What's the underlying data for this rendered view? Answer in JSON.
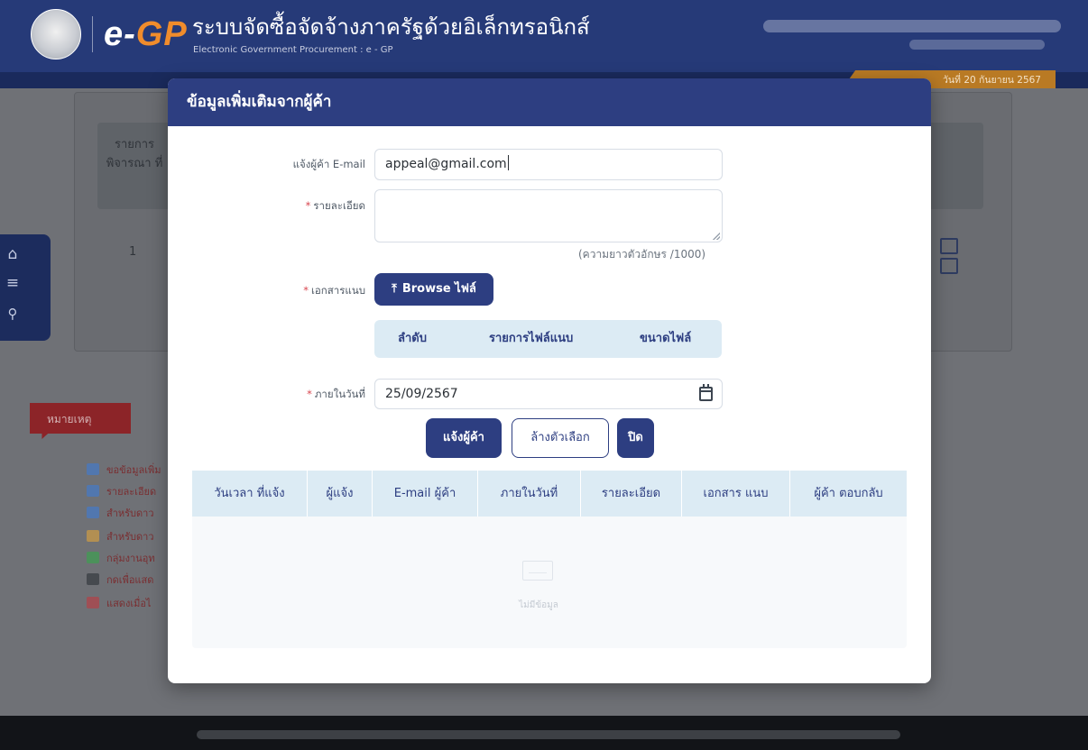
{
  "header": {
    "brand_prefix": "e-",
    "brand_suffix": "GP",
    "system_name": "ระบบจัดซื้อจัดจ้างภาครัฐด้วยอิเล็กทรอนิกส์",
    "system_name_en": "Electronic Government Procurement : e - GP",
    "date_text": "วันที่ 20 กันยายน 2567"
  },
  "background_page": {
    "column_header": "รายการ พิจารณา ที่",
    "row_number": "1",
    "notes_title": "หมายเหตุ",
    "note_items": [
      {
        "label": "ขอข้อมูลเพิ่ม",
        "color": "#3d7bd6"
      },
      {
        "label": "รายละเอียด",
        "color": "#3d7bd6"
      },
      {
        "label": "สำหรับดาว",
        "color": "#3d7bd6"
      },
      {
        "label": "สำหรับดาว",
        "color": "#e0a33a"
      },
      {
        "label": "กลุ่มงานอุท",
        "color": "#35a64a"
      },
      {
        "label": "กดเพื่อแสด",
        "color": "#2b3036"
      },
      {
        "label": "แสดงเมื่อไ",
        "color": "#c0393f"
      }
    ]
  },
  "side_nav": {
    "icons": [
      "home-icon",
      "menu-icon",
      "search-icon"
    ]
  },
  "modal": {
    "title": "ข้อมูลเพิ่มเติมจากผู้ค้า",
    "form": {
      "email_label": "แจ้งผู้ค้า E-mail",
      "email_value": "appeal@gmail.com",
      "detail_label": "รายละเอียด",
      "detail_counter": "(ความยาวตัวอักษร /1000)",
      "attachment_label": "เอกสารแนบ",
      "browse_button": "Browse ไฟล์",
      "file_table_headers": [
        "ลำดับ",
        "รายการไฟล์แนบ",
        "ขนาดไฟล์"
      ],
      "due_date_label": "ภายในวันที่",
      "due_date_value": "25/09/2567"
    },
    "actions": {
      "notify_button": "แจ้งผู้ค้า",
      "clear_button": "ล้างตัวเลือก",
      "close_button": "ปิด"
    },
    "history_table": {
      "headers": [
        "วันเวลา ที่แจ้ง",
        "ผู้แจ้ง",
        "E-mail ผู้ค้า",
        "ภายในวันที่",
        "รายละเอียด",
        "เอกสาร แนบ",
        "ผู้ค้า ตอบกลับ"
      ],
      "empty_text": "ไม่มีข้อมูล"
    }
  },
  "colors": {
    "primary": "#2d3e81",
    "header_bg": "#263a78",
    "table_header_bg": "#dcebf4",
    "required_mark": "#d8464f",
    "brand_orange": "#f08c2c"
  }
}
